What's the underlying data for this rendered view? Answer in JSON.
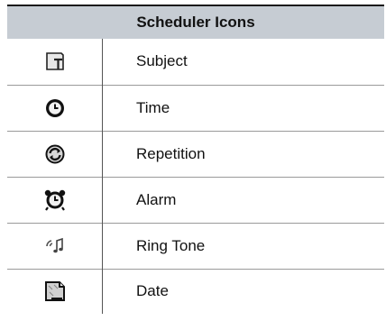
{
  "table": {
    "title": "Scheduler Icons",
    "rows": [
      {
        "icon": "subject-icon",
        "label": "Subject"
      },
      {
        "icon": "clock-icon",
        "label": "Time"
      },
      {
        "icon": "repeat-icon",
        "label": "Repetition"
      },
      {
        "icon": "alarm-clock-icon",
        "label": "Alarm"
      },
      {
        "icon": "ring-tone-icon",
        "label": "Ring Tone"
      },
      {
        "icon": "date-icon",
        "label": "Date"
      }
    ]
  }
}
